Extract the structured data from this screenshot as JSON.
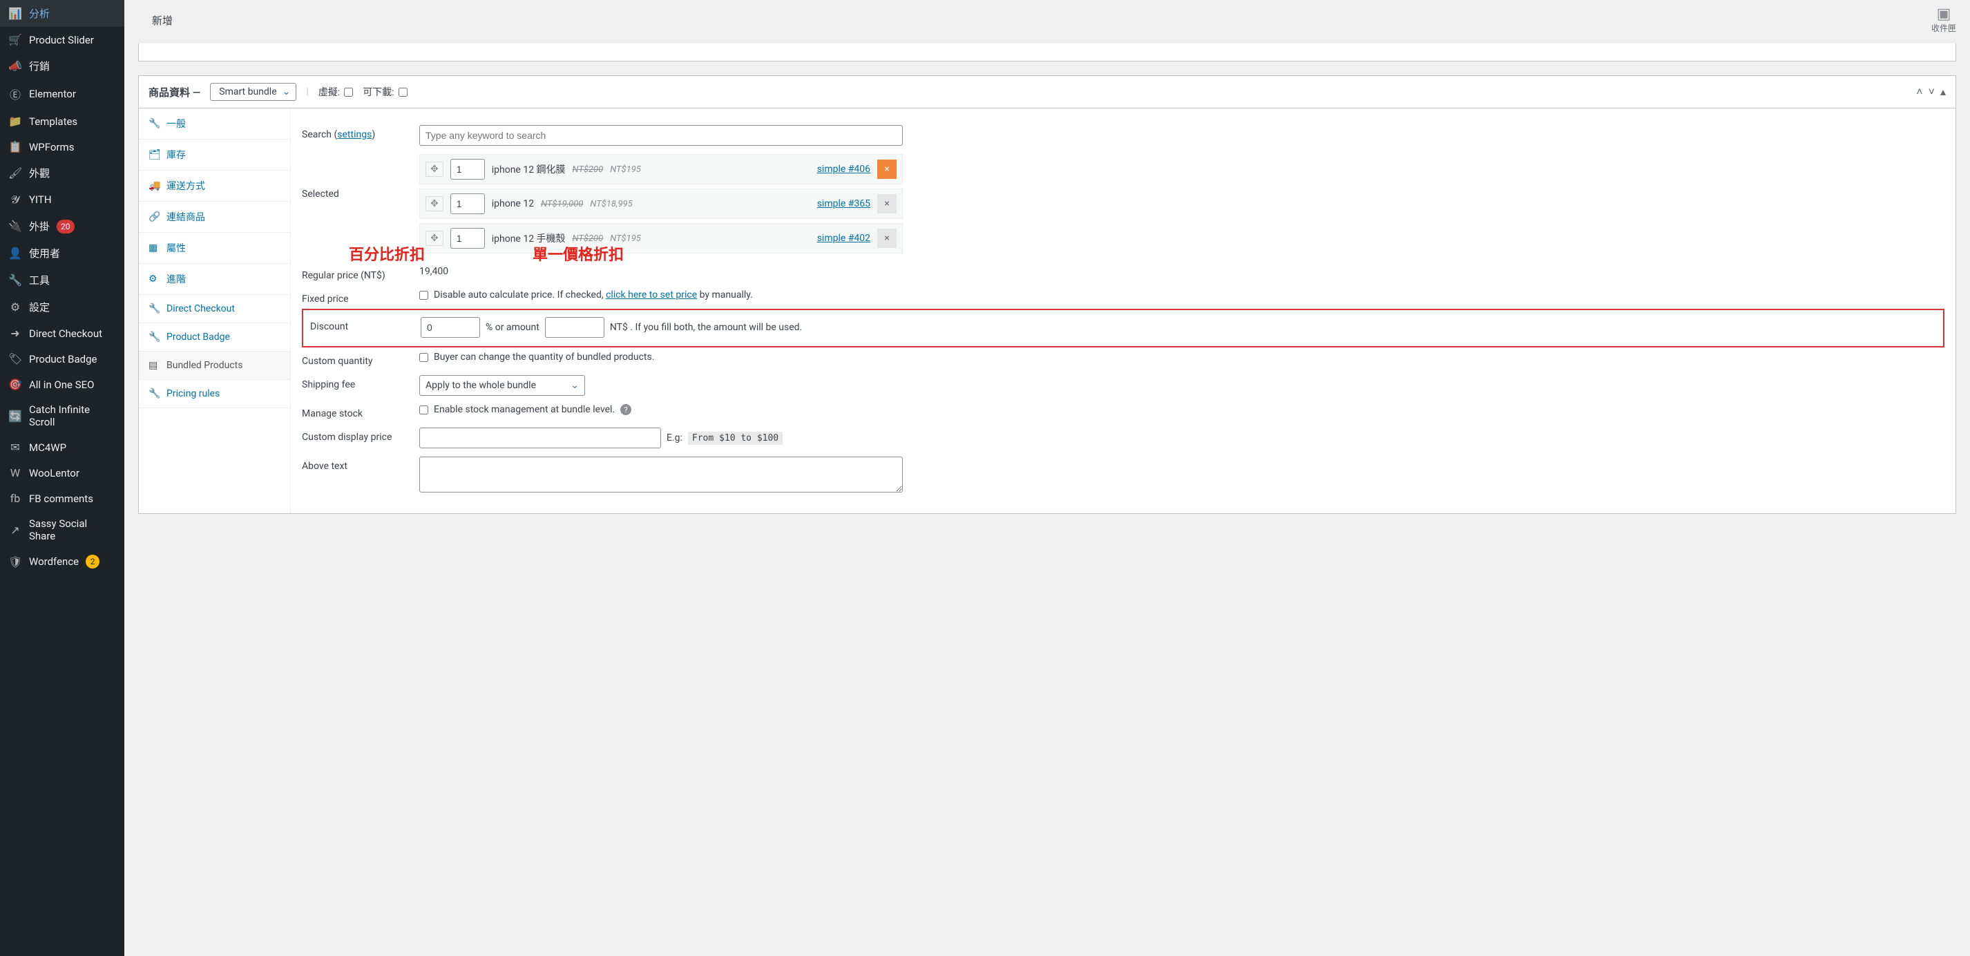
{
  "top": {
    "add_new": "新增",
    "inbox": "收件匣"
  },
  "sidebar": {
    "items": [
      {
        "label": "分析",
        "icon": "📊"
      },
      {
        "label": "Product Slider",
        "icon": "🛒"
      },
      {
        "label": "行銷",
        "icon": "📣"
      },
      {
        "label": "Elementor",
        "icon": "Ⓔ"
      },
      {
        "label": "Templates",
        "icon": "📁"
      },
      {
        "label": "WPForms",
        "icon": "📋"
      },
      {
        "label": "外觀",
        "icon": "🖌"
      },
      {
        "label": "YITH",
        "icon": "𝓨"
      },
      {
        "label": "外掛",
        "icon": "🔌",
        "badge": "20"
      },
      {
        "label": "使用者",
        "icon": "👤"
      },
      {
        "label": "工具",
        "icon": "🔧"
      },
      {
        "label": "設定",
        "icon": "⚙"
      },
      {
        "label": "Direct Checkout",
        "icon": "➜"
      },
      {
        "label": "Product Badge",
        "icon": "🏷"
      },
      {
        "label": "All in One SEO",
        "icon": "🎯"
      },
      {
        "label": "Catch Infinite Scroll",
        "icon": "🔄"
      },
      {
        "label": "MC4WP",
        "icon": "✉"
      },
      {
        "label": "WooLentor",
        "icon": "W"
      },
      {
        "label": "FB comments",
        "icon": "fb"
      },
      {
        "label": "Sassy Social Share",
        "icon": "↗"
      },
      {
        "label": "Wordfence",
        "icon": "🛡",
        "badge_y": "2"
      }
    ]
  },
  "postbox": {
    "title": "商品資料",
    "type_selected": "Smart bundle",
    "virtual_label": "虛擬:",
    "download_label": "可下載:"
  },
  "tabs": [
    {
      "label": "一般",
      "icon": "🔧"
    },
    {
      "label": "庫存",
      "icon": "🗂"
    },
    {
      "label": "運送方式",
      "icon": "🚚"
    },
    {
      "label": "連結商品",
      "icon": "🔗"
    },
    {
      "label": "屬性",
      "icon": "▦"
    },
    {
      "label": "進階",
      "icon": "⚙"
    },
    {
      "label": "Direct Checkout",
      "icon": "🔧"
    },
    {
      "label": "Product Badge",
      "icon": "🔧"
    },
    {
      "label": "Bundled Products",
      "icon": "▤",
      "current": true
    },
    {
      "label": "Pricing rules",
      "icon": "🔧"
    }
  ],
  "form": {
    "search_label": "Search (",
    "search_settings": "settings",
    "search_close": ")",
    "search_placeholder": "Type any keyword to search",
    "selected_label": "Selected",
    "items": [
      {
        "qty": "1",
        "name": "iphone 12 鋼化膜",
        "old": "NT$200",
        "new": "NT$195",
        "tag": "simple #406",
        "rm_orange": true
      },
      {
        "qty": "1",
        "name": "iphone 12",
        "old": "NT$19,000",
        "new": "NT$18,995",
        "tag": "simple #365",
        "rm_orange": false
      },
      {
        "qty": "1",
        "name": "iphone 12 手機殼",
        "old": "NT$200",
        "new": "NT$195",
        "tag": "simple #402",
        "rm_orange": false
      }
    ],
    "regular_price_label": "Regular price (NT$)",
    "regular_price_value": "19,400",
    "fixed_price_label": "Fixed price",
    "fixed_price_cb_text1": "Disable auto calculate price. If checked, ",
    "fixed_price_link": "click here to set price",
    "fixed_price_cb_text2": " by manually.",
    "discount_label": "Discount",
    "discount_pct_value": "0",
    "discount_mid": "% or amount",
    "discount_tail": "NT$ . If you fill both, the amount will be used.",
    "custom_qty_label": "Custom quantity",
    "custom_qty_text": "Buyer can change the quantity of bundled products.",
    "shipping_label": "Shipping fee",
    "shipping_value": "Apply to the whole bundle",
    "stock_label": "Manage stock",
    "stock_text": "Enable stock management at bundle level.",
    "display_price_label": "Custom display price",
    "display_price_hint_pre": "E.g:",
    "display_price_hint": "From $10 to $100",
    "above_text_label": "Above text"
  },
  "anno": {
    "left": "百分比折扣",
    "right": "單一價格折扣"
  }
}
